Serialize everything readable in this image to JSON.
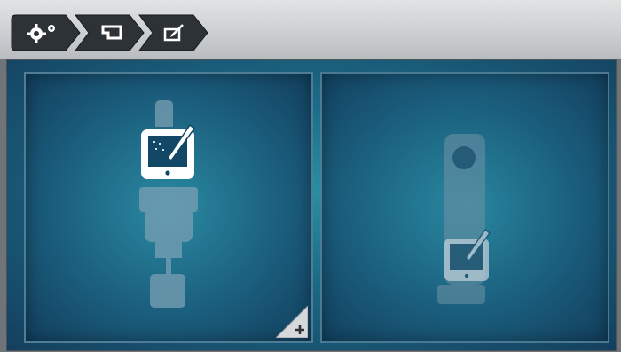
{
  "breadcrumb": {
    "items": [
      {
        "id": "settings",
        "icon": "gears-icon"
      },
      {
        "id": "machine",
        "icon": "presser-foot-icon"
      },
      {
        "id": "edit",
        "icon": "edit-icon"
      }
    ]
  },
  "panels": [
    {
      "id": "hoop-attach-on-top",
      "icon": "tablet-pen-on-arm-icon",
      "has_add_button": true
    },
    {
      "id": "hoop-attach-lower",
      "icon": "tablet-pen-on-hoop-icon",
      "has_add_button": false
    }
  ],
  "colors": {
    "topbar": "#cdd0d2",
    "crumb_fill": "#2d3236",
    "stage_center": "#2a8ea3",
    "stage_edge": "#143f5e",
    "icon_highlight": "#ffffff",
    "icon_ghost": "#6f93a6"
  }
}
